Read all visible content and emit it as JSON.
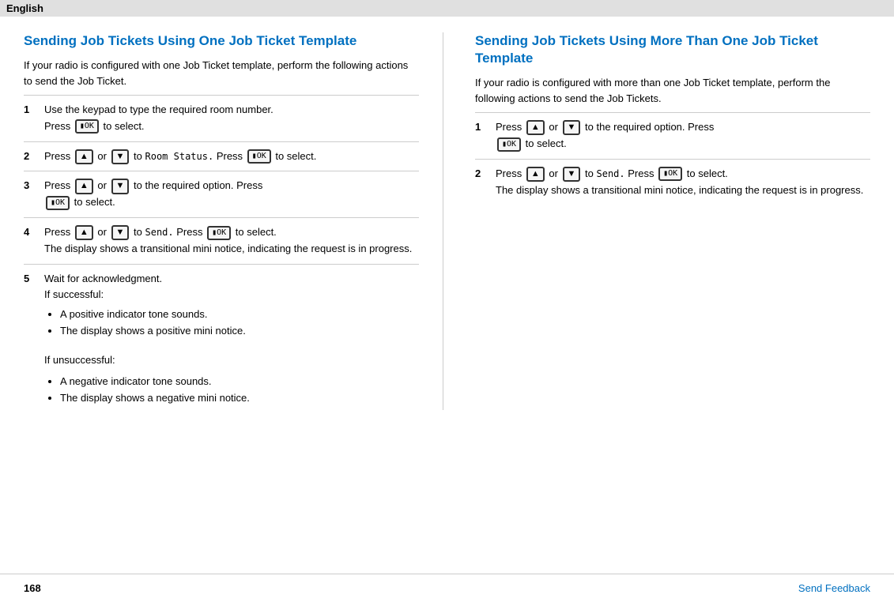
{
  "lang_bar": {
    "label": "English"
  },
  "left": {
    "title": "Sending Job Tickets Using One Job Ticket Template",
    "intro": "If your radio is configured with one Job Ticket template, perform the following actions to send the Job Ticket.",
    "steps": [
      {
        "num": "1",
        "lines": [
          "Use the keypad to type the required room number.",
          "Press [OK] to select."
        ]
      },
      {
        "num": "2",
        "lines": [
          "Press [UP] or [DOWN] to Room Status. Press [OK] to select."
        ]
      },
      {
        "num": "3",
        "lines": [
          "Press [UP] or [DOWN] to the required option. Press [OK] to select."
        ]
      },
      {
        "num": "4",
        "lines": [
          "Press [UP] or [DOWN] to Send. Press [OK] to select.",
          "The display shows a transitional mini notice, indicating the request is in progress."
        ]
      },
      {
        "num": "5",
        "lines": [
          "Wait for acknowledgment.",
          "If successful:"
        ]
      }
    ],
    "successful_bullets": [
      "A positive indicator tone sounds.",
      "The display shows a positive mini notice."
    ],
    "unsuccessful_label": "If unsuccessful:",
    "unsuccessful_bullets": [
      "A negative indicator tone sounds.",
      "The display shows a negative mini notice."
    ]
  },
  "right": {
    "title": "Sending Job Tickets Using More Than One Job Ticket Template",
    "intro": "If your radio is configured with more than one Job Ticket template, perform the following actions to send the Job Tickets.",
    "steps": [
      {
        "num": "1",
        "lines": [
          "Press [UP] or [DOWN] to the required option. Press [OK] to select."
        ]
      },
      {
        "num": "2",
        "lines": [
          "Press [UP] or [DOWN] to Send. Press [OK] to select.",
          "The display shows a transitional mini notice, indicating the request is in progress."
        ]
      }
    ]
  },
  "footer": {
    "page_num": "168",
    "send_feedback": "Send Feedback"
  }
}
